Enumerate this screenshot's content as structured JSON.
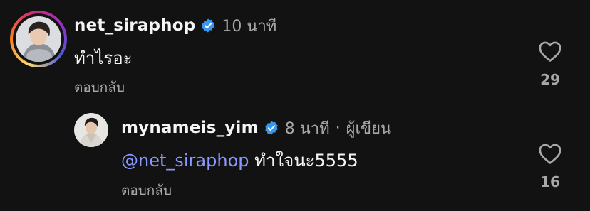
{
  "comments": [
    {
      "username": "net_siraphop",
      "verified": true,
      "time_ago": "10 นาที",
      "text": "ทำไรอะ",
      "reply_label": "ตอบกลับ",
      "likes": "29",
      "avatar_story_ring": true
    }
  ],
  "replies": [
    {
      "username": "mynameis_yim",
      "verified": true,
      "time_ago": "8 นาที",
      "separator": "·",
      "author_tag": "ผู้เขียน",
      "mention": "@net_siraphop",
      "text": " ทำใจนะ5555",
      "reply_label": "ตอบกลับ",
      "likes": "16"
    }
  ],
  "colors": {
    "background": "#121212",
    "verified_badge": "#3897f0",
    "mention": "#8a99ff",
    "muted_text": "#a8a8a8"
  },
  "icons": {
    "verified": "verified-badge-icon",
    "like": "heart-outline-icon"
  }
}
